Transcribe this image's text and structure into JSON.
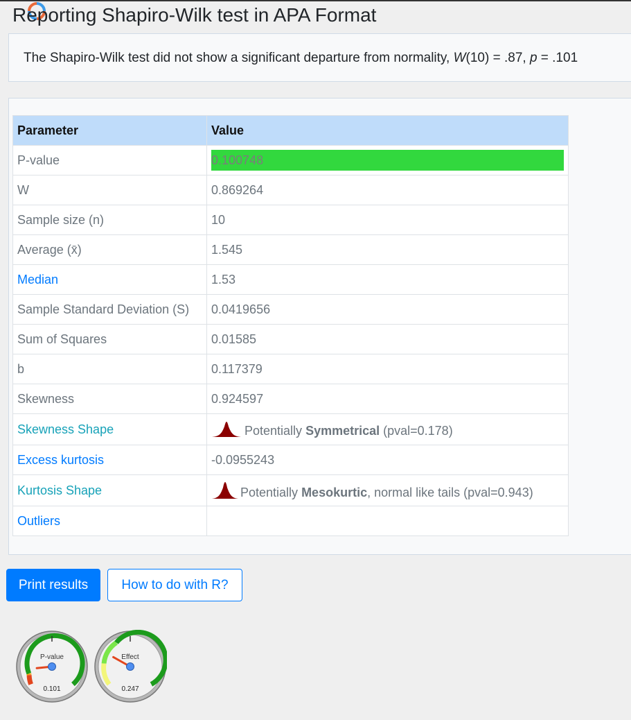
{
  "page": {
    "title": "Reporting Shapiro-Wilk test in APA Format",
    "apa_sentence": {
      "prefix": "The Shapiro-Wilk test did not show a significant departure from normality, ",
      "w_symbol": "W",
      "df": "(10) = .87, ",
      "p_symbol": "p",
      "p_value": " = .101"
    }
  },
  "table": {
    "headers": [
      "Parameter",
      "Value"
    ],
    "rows": {
      "pvalue": {
        "label": "P-value",
        "value": "0.100748"
      },
      "w": {
        "label": "W",
        "value": "0.869264"
      },
      "n": {
        "label": "Sample size (n)",
        "value": "10"
      },
      "avg": {
        "label": "Average (x̄)",
        "value": "1.545"
      },
      "median": {
        "label": "Median",
        "value": "1.53"
      },
      "sd": {
        "label": "Sample Standard Deviation (S)",
        "value": "0.0419656"
      },
      "ss": {
        "label": "Sum of Squares",
        "value": "0.01585"
      },
      "b": {
        "label": "b",
        "value": "0.117379"
      },
      "skew": {
        "label": "Skewness",
        "value": "0.924597"
      },
      "skew_shape": {
        "label": "Skewness Shape",
        "pre": "Potentially ",
        "bold": "Symmetrical",
        "post": " (pval=0.178)"
      },
      "kurt": {
        "label": "Excess kurtosis",
        "value": "-0.0955243"
      },
      "kurt_shape": {
        "label": "Kurtosis Shape",
        "pre": "Potentially ",
        "bold": "Mesokurtic",
        "post": ", normal like tails (pval=0.943)"
      },
      "outliers": {
        "label": "Outliers",
        "value": ""
      }
    }
  },
  "buttons": {
    "print": "Print results",
    "how_r": "How to do with R?"
  },
  "gauges": {
    "pvalue": {
      "title": "P-value",
      "value": "0.101",
      "fraction": 0.101
    },
    "effect": {
      "title": "Effect",
      "value": "0.247",
      "fraction": 0.247
    }
  },
  "colors": {
    "accent": "#007bff",
    "teal_link": "#17a2b8",
    "header_bg": "#bfdcfa",
    "pvalue_bar": "#32d83e",
    "shape_icon": "#8b0000"
  },
  "icons": {
    "spinner": "refresh-spinner-icon",
    "shape": "bell-curve-icon"
  }
}
